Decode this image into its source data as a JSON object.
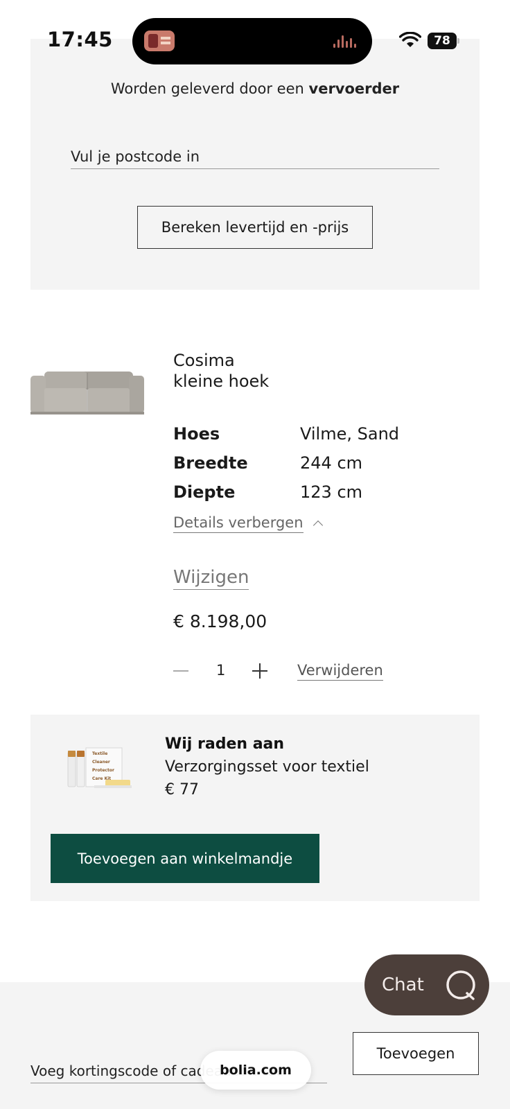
{
  "status_bar": {
    "time": "17:45",
    "battery": "78"
  },
  "delivery": {
    "text_prefix": "Worden geleverd door een ",
    "text_bold": "vervoerder",
    "postcode_placeholder": "Vul je postcode in",
    "calculate_button": "Bereken levertijd en -prijs"
  },
  "product": {
    "name_line1": "Cosima",
    "name_line2": "kleine hoek",
    "specs": [
      {
        "label": "Hoes",
        "value": "Vilme, Sand"
      },
      {
        "label": "Breedte",
        "value": "244 cm"
      },
      {
        "label": "Diepte",
        "value": "123 cm"
      }
    ],
    "details_toggle": "Details verbergen",
    "change_link": "Wijzigen",
    "price": "€ 8.198,00",
    "quantity": "1",
    "remove_link": "Verwijderen"
  },
  "recommendation": {
    "title": "Wij raden aan",
    "name": "Verzorgingsset voor textiel",
    "price": "€ 77",
    "add_button": "Toevoegen aan winkelmandje",
    "box_labels": [
      "Textile",
      "Cleaner",
      "Protector",
      "Care Kit"
    ]
  },
  "chat": {
    "label": "Chat"
  },
  "discount": {
    "placeholder": "Voeg kortingscode of cadeaubon toe",
    "apply_button": "Toevoegen"
  },
  "browser": {
    "url": "bolia.com"
  },
  "colors": {
    "panel_bg": "#f4f4f4",
    "accent_green": "#0d4d41",
    "chat_brown": "#4c3f3a"
  }
}
